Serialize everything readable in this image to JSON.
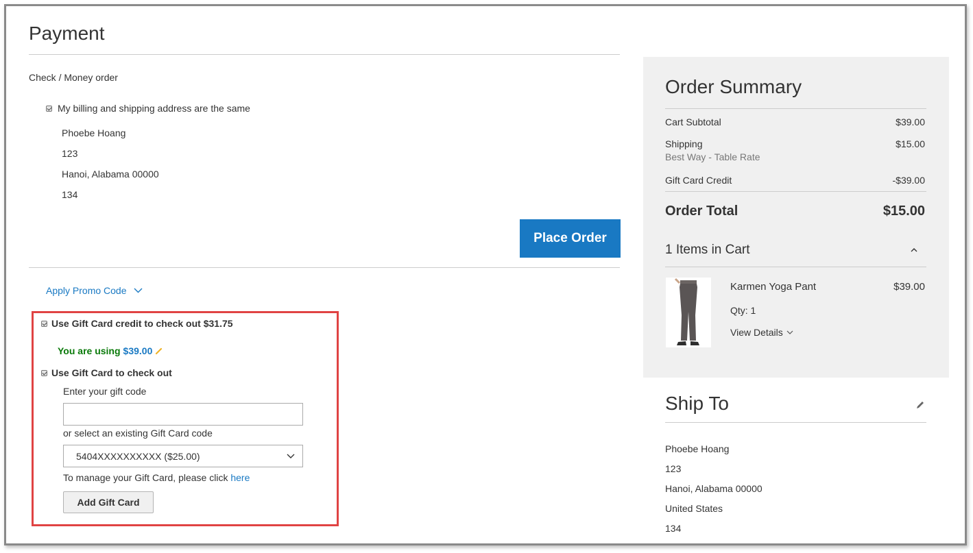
{
  "payment": {
    "title": "Payment",
    "method": "Check / Money order",
    "same_address_label": "My billing and shipping address are the same",
    "address": [
      "Phoebe Hoang",
      "123",
      "Hanoi, Alabama 00000",
      "134"
    ],
    "place_order_label": "Place Order",
    "promo_label": "Apply Promo Code",
    "giftcard_credit_label": "Use Gift Card credit to check out $31.75",
    "using_prefix": "You are using",
    "using_amount": "$39.00",
    "use_giftcard_label": "Use Gift Card to check out",
    "enter_code_label": "Enter your gift code",
    "code_value": "",
    "select_label": "or select an existing Gift Card code",
    "select_value": "5404XXXXXXXXXX ($25.00)",
    "manage_prefix": "To manage your Gift Card, please click",
    "manage_link": "here",
    "add_button_label": "Add Gift Card"
  },
  "summary": {
    "title": "Order Summary",
    "rows": [
      {
        "label": "Cart Subtotal",
        "value": "$39.00"
      },
      {
        "label": "Shipping",
        "sub": "Best Way - Table Rate",
        "value": "$15.00"
      },
      {
        "label": "Gift Card Credit",
        "value": "-$39.00"
      }
    ],
    "total_label": "Order Total",
    "total_value": "$15.00",
    "items_label": "1 Items in Cart",
    "item": {
      "name": "Karmen Yoga Pant",
      "price": "$39.00",
      "qty": "Qty: 1",
      "details": "View Details"
    }
  },
  "ship_to": {
    "title": "Ship To",
    "address": [
      "Phoebe Hoang",
      "123",
      "Hanoi, Alabama 00000",
      "United States",
      "134"
    ]
  },
  "colors": {
    "accent": "#1979c3",
    "highlight": "#e04343",
    "success": "#0a7a0a"
  },
  "icons": [
    "checkbox-checked",
    "chevron-down",
    "chevron-up",
    "pencil",
    "edit"
  ]
}
